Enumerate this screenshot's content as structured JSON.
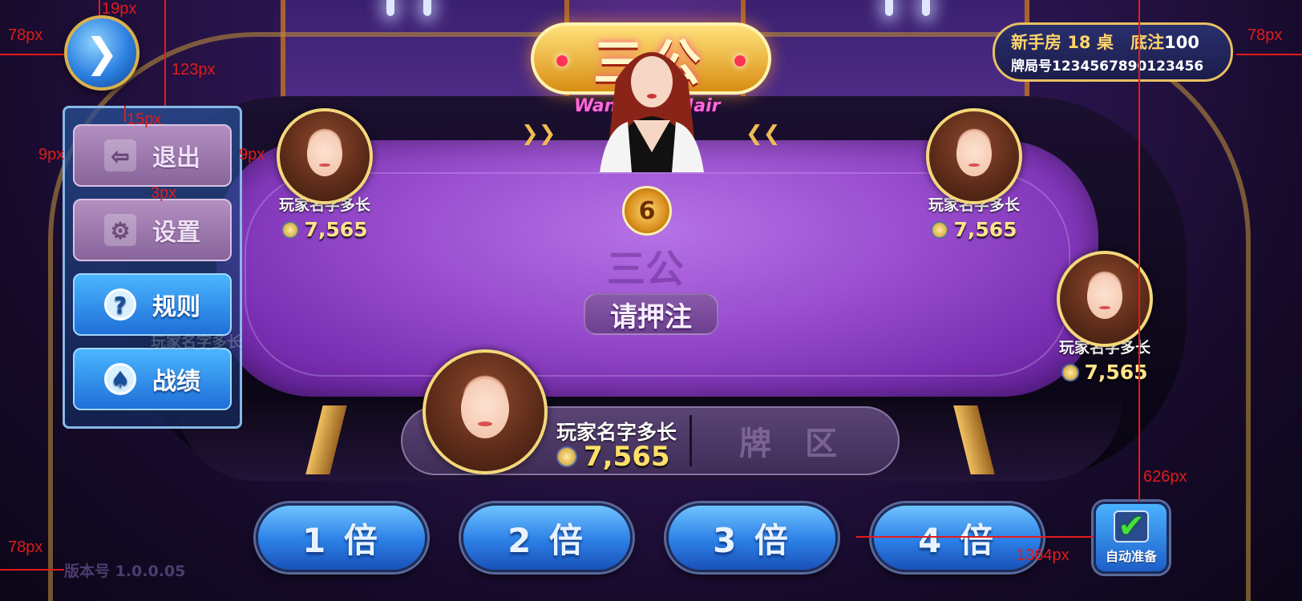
{
  "logo": {
    "title": "三公",
    "subtitle": "Wang Zha Hair"
  },
  "room": {
    "room_type": "新手房",
    "table_no": "18",
    "table_unit": "桌",
    "base_bet_label": "底注",
    "base_bet_value": "100",
    "round_label": "牌局号",
    "round_id": "1234567890123456"
  },
  "table": {
    "countdown": "6",
    "watermark": "三公",
    "prompt": "请押注"
  },
  "menu": {
    "toggle_icon": "chevron-right-icon",
    "items": [
      {
        "label": "退出",
        "icon": "exit-icon",
        "state": "disabled"
      },
      {
        "label": "设置",
        "icon": "gear-icon",
        "state": "disabled"
      },
      {
        "label": "规则",
        "icon": "question-icon",
        "state": "active"
      },
      {
        "label": "战绩",
        "icon": "medal-icon",
        "state": "active"
      }
    ]
  },
  "players": [
    {
      "seat": "top-left",
      "name": "玩家名字多长",
      "coins": "7,565"
    },
    {
      "seat": "top-right",
      "name": "玩家名字多长",
      "coins": "7,565"
    },
    {
      "seat": "right",
      "name": "玩家名字多长",
      "coins": "7,565"
    },
    {
      "seat": "left-hidden",
      "name": "玩家名字多长",
      "coins": "7,565"
    }
  ],
  "self": {
    "name": "玩家名字多长",
    "coins": "7,565",
    "card_zone": "牌 区"
  },
  "bet_buttons": [
    "1 倍",
    "2 倍",
    "3 倍",
    "4 倍"
  ],
  "auto_ready": {
    "label": "自动准备",
    "checked": true
  },
  "version": "版本号 1.0.0.05",
  "annotations": {
    "a1": "19px",
    "a2": "78px",
    "a3": "123px",
    "a4": "15px",
    "a5": "9px",
    "a6": "9px",
    "a7": "3px",
    "a8": "78px",
    "a9": "626px",
    "a10": "78px",
    "a11": "1364px"
  },
  "colors": {
    "felt": "#9a4fcf",
    "gold": "#e8c062",
    "button_blue": "#2b7fe6",
    "annotation": "#e21b1b"
  }
}
